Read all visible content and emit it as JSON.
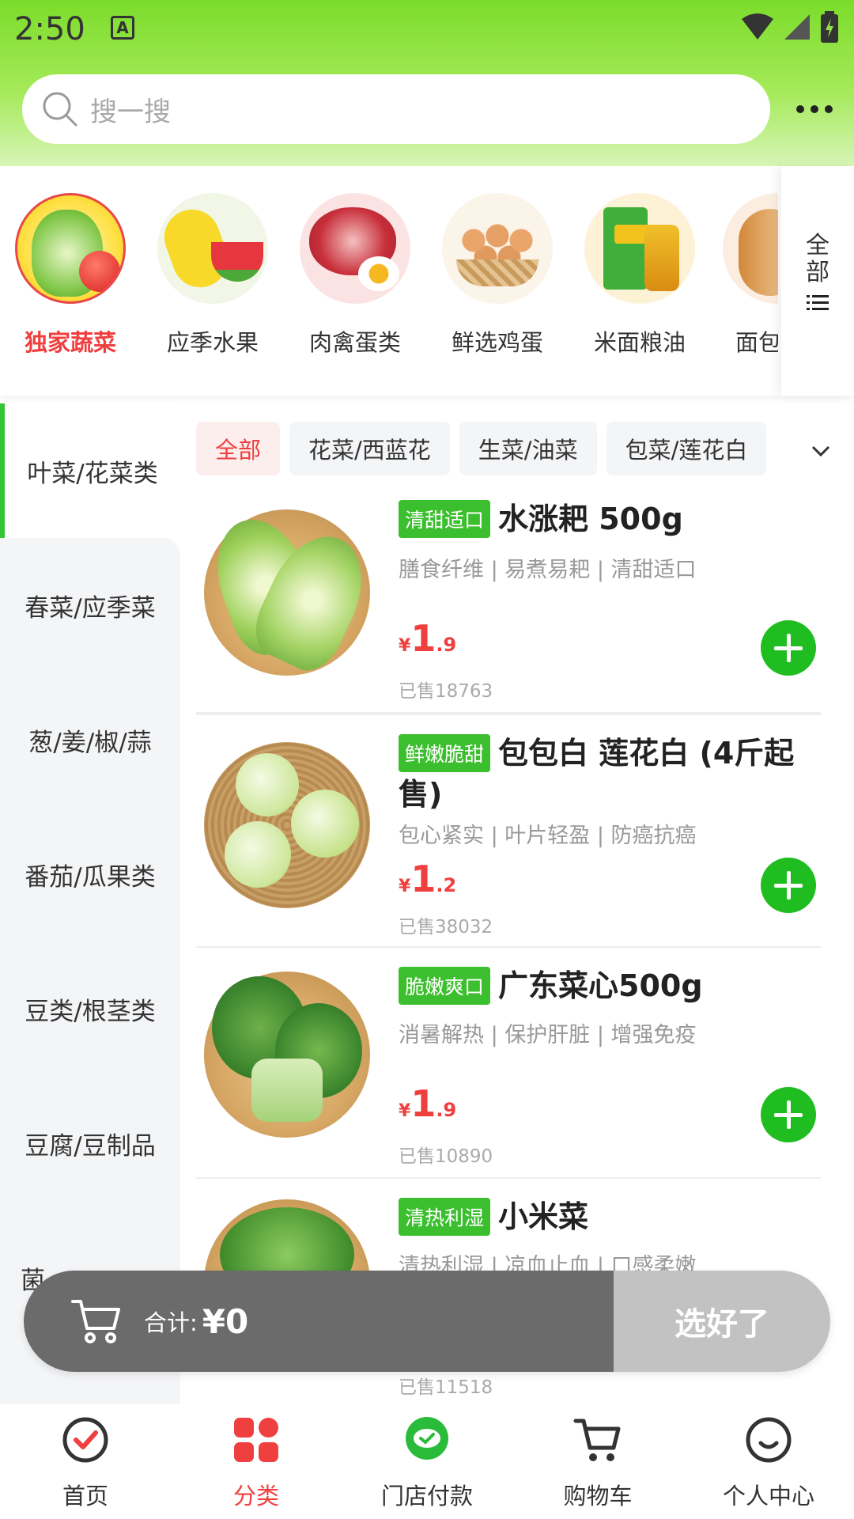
{
  "status": {
    "time": "2:50"
  },
  "search": {
    "placeholder": "搜一搜"
  },
  "categories": {
    "items": [
      {
        "label": "独家蔬菜"
      },
      {
        "label": "应季水果"
      },
      {
        "label": "肉禽蛋类"
      },
      {
        "label": "鲜选鸡蛋"
      },
      {
        "label": "米面粮油"
      },
      {
        "label": "面包"
      }
    ],
    "all_label": "全部"
  },
  "sidebar": {
    "items": [
      {
        "label": "叶菜/花菜类"
      },
      {
        "label": "春菜/应季菜"
      },
      {
        "label": "葱/姜/椒/蒜"
      },
      {
        "label": "番茄/瓜果类"
      },
      {
        "label": "豆类/根茎类"
      },
      {
        "label": "豆腐/豆制品"
      },
      {
        "label": "菌"
      }
    ]
  },
  "chips": [
    {
      "label": "全部"
    },
    {
      "label": "花菜/西蓝花"
    },
    {
      "label": "生菜/油菜"
    },
    {
      "label": "包菜/莲花白"
    }
  ],
  "products": [
    {
      "tag": "清甜适口",
      "title": "水涨耙 500g",
      "desc": "膳食纤维 | 易煮易耙 | 清甜适口",
      "price_int": "1",
      "price_dec": ".9",
      "currency": "¥",
      "sold": "已售18763"
    },
    {
      "tag": "鲜嫩脆甜",
      "title": "包包白 莲花白 (4斤起售)",
      "desc": "包心紧实 | 叶片轻盈 | 防癌抗癌",
      "price_int": "1",
      "price_dec": ".2",
      "currency": "¥",
      "sold": "已售38032"
    },
    {
      "tag": "脆嫩爽口",
      "title": "广东菜心500g",
      "desc": "消暑解热 | 保护肝脏 | 增强免疫",
      "price_int": "1",
      "price_dec": ".9",
      "currency": "¥",
      "sold": "已售10890"
    },
    {
      "tag": "清热利湿",
      "title": "小米菜",
      "desc": "清热利湿 | 凉血止血 | 口感柔嫩",
      "sold": "已售11518"
    }
  ],
  "cart": {
    "total_label": "合计:",
    "total_value": "¥0",
    "checkout_label": "选好了"
  },
  "nav": [
    {
      "label": "首页"
    },
    {
      "label": "分类"
    },
    {
      "label": "门店付款"
    },
    {
      "label": "购物车"
    },
    {
      "label": "个人中心"
    }
  ],
  "colors": {
    "accent_red": "#ef3f3f",
    "accent_green": "#1fbd1f",
    "tag_green": "#3cbf2e"
  }
}
